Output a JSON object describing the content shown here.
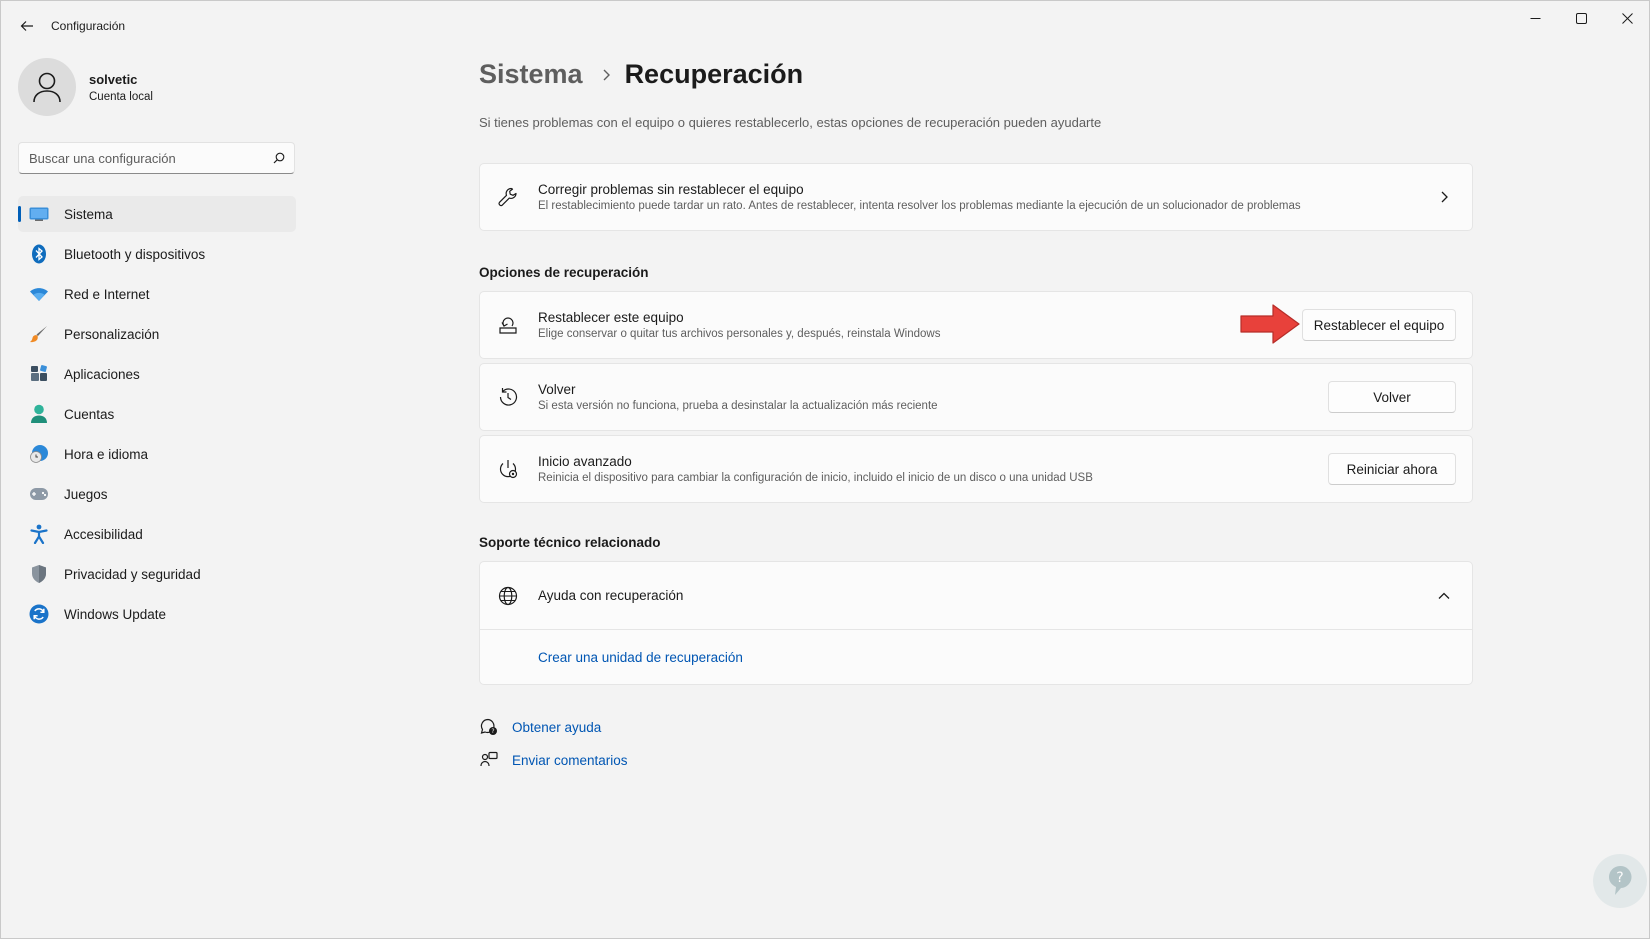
{
  "window": {
    "title": "Configuración"
  },
  "profile": {
    "name": "solvetic",
    "account_type": "Cuenta local"
  },
  "search": {
    "placeholder": "Buscar una configuración"
  },
  "sidebar": {
    "items": [
      {
        "label": "Sistema",
        "icon": "system-icon",
        "active": true
      },
      {
        "label": "Bluetooth y dispositivos",
        "icon": "bluetooth-icon"
      },
      {
        "label": "Red e Internet",
        "icon": "wifi-icon"
      },
      {
        "label": "Personalización",
        "icon": "brush-icon"
      },
      {
        "label": "Aplicaciones",
        "icon": "apps-icon"
      },
      {
        "label": "Cuentas",
        "icon": "account-icon"
      },
      {
        "label": "Hora e idioma",
        "icon": "clock-globe-icon"
      },
      {
        "label": "Juegos",
        "icon": "gamepad-icon"
      },
      {
        "label": "Accesibilidad",
        "icon": "accessibility-icon"
      },
      {
        "label": "Privacidad y seguridad",
        "icon": "shield-icon"
      },
      {
        "label": "Windows Update",
        "icon": "update-icon"
      }
    ]
  },
  "breadcrumb": {
    "parent": "Sistema",
    "current": "Recuperación"
  },
  "page": {
    "subtitle": "Si tienes problemas con el equipo o quieres restablecerlo, estas opciones de recuperación pueden ayudarte"
  },
  "troubleshoot": {
    "title": "Corregir problemas sin restablecer el equipo",
    "description": "El restablecimiento puede tardar un rato. Antes de restablecer, intenta resolver los problemas mediante la ejecución de un solucionador de problemas"
  },
  "recovery_options": {
    "heading": "Opciones de recuperación",
    "items": [
      {
        "title": "Restablecer este equipo",
        "description": "Elige conservar o quitar tus archivos personales y, después, reinstala Windows",
        "button": "Restablecer el equipo"
      },
      {
        "title": "Volver",
        "description": "Si esta versión no funciona, prueba a desinstalar la actualización más reciente",
        "button": "Volver"
      },
      {
        "title": "Inicio avanzado",
        "description": "Reinicia el dispositivo para cambiar la configuración de inicio, incluido el inicio de un disco o una unidad USB",
        "button": "Reiniciar ahora"
      }
    ]
  },
  "support": {
    "heading": "Soporte técnico relacionado",
    "help_title": "Ayuda con recuperación",
    "link": "Crear una unidad de recuperación"
  },
  "footer": {
    "get_help": "Obtener ayuda",
    "feedback": "Enviar comentarios"
  },
  "colors": {
    "accent": "#005fb8",
    "link": "#0056b3",
    "annotation_arrow": "#e8413b"
  }
}
